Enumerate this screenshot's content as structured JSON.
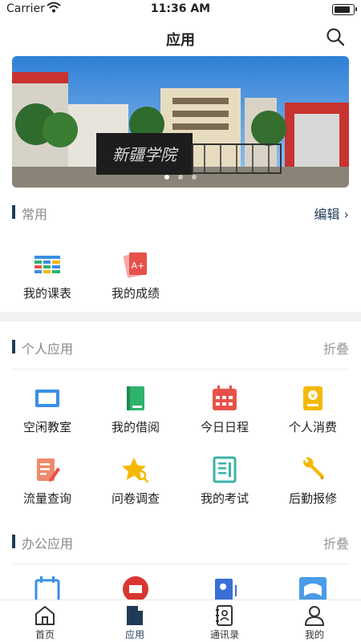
{
  "status": {
    "carrier": "Carrier",
    "time": "11:36 AM"
  },
  "header": {
    "title": "应用",
    "search_icon": "search-icon"
  },
  "banner": {
    "sign_text": "新疆学院",
    "slides": 3,
    "active_slide": 1
  },
  "common": {
    "title": "常用",
    "action": "编辑 ›",
    "apps": [
      {
        "label": "我的课表",
        "icon": "timetable-icon"
      },
      {
        "label": "我的成绩",
        "icon": "grade-icon"
      }
    ]
  },
  "personal": {
    "title": "个人应用",
    "action": "折叠",
    "apps": [
      {
        "label": "空闲教室",
        "icon": "classroom-icon"
      },
      {
        "label": "我的借阅",
        "icon": "book-icon"
      },
      {
        "label": "今日日程",
        "icon": "calendar-icon"
      },
      {
        "label": "个人消费",
        "icon": "wallet-icon"
      },
      {
        "label": "流量查询",
        "icon": "traffic-icon"
      },
      {
        "label": "问卷调查",
        "icon": "survey-icon"
      },
      {
        "label": "我的考试",
        "icon": "exam-icon"
      },
      {
        "label": "后勤报修",
        "icon": "wrench-icon"
      }
    ]
  },
  "office": {
    "title": "办公应用",
    "action": "折叠",
    "apps": [
      {
        "icon": "schedule-icon"
      },
      {
        "icon": "mail-icon"
      },
      {
        "icon": "contact-card-icon"
      },
      {
        "icon": "library-icon"
      }
    ]
  },
  "tabs": [
    {
      "label": "首页",
      "icon": "home-icon"
    },
    {
      "label": "应用",
      "icon": "apps-icon",
      "active": true
    },
    {
      "label": "通讯录",
      "icon": "contacts-icon"
    },
    {
      "label": "我的",
      "icon": "profile-icon"
    }
  ],
  "colors": {
    "accent": "#1f3b57",
    "blue": "#3a8ee6",
    "red": "#e8514a",
    "green": "#2db36b",
    "yellow": "#f5b800",
    "teal": "#3ab3a6"
  }
}
